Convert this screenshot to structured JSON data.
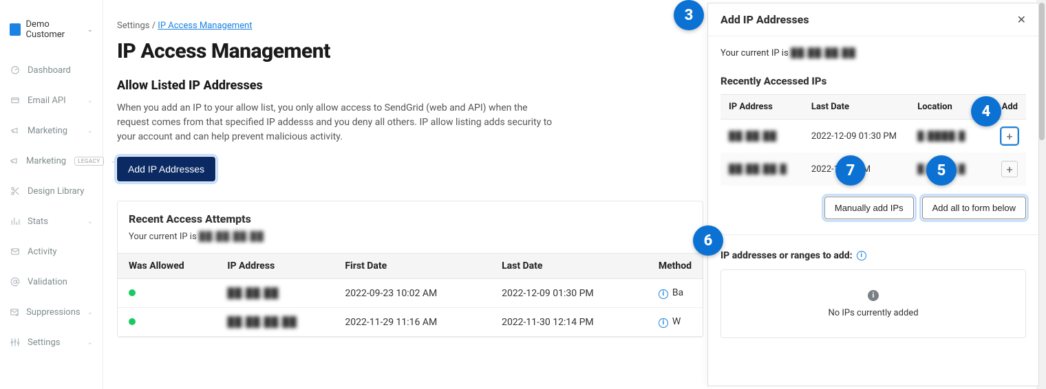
{
  "brand": {
    "name": "Demo Customer"
  },
  "sidebar": {
    "items": [
      {
        "label": "Dashboard",
        "icon": "gauge",
        "expandable": false
      },
      {
        "label": "Email API",
        "icon": "card",
        "expandable": true
      },
      {
        "label": "Marketing",
        "icon": "megaphone",
        "expandable": true
      },
      {
        "label": "Marketing",
        "icon": "megaphone",
        "expandable": true,
        "badge": "LEGACY"
      },
      {
        "label": "Design Library",
        "icon": "scissors",
        "expandable": false
      },
      {
        "label": "Stats",
        "icon": "bars",
        "expandable": true
      },
      {
        "label": "Activity",
        "icon": "mail",
        "expandable": false
      },
      {
        "label": "Validation",
        "icon": "at",
        "expandable": false
      },
      {
        "label": "Suppressions",
        "icon": "envelope-x",
        "expandable": true
      },
      {
        "label": "Settings",
        "icon": "sliders",
        "expandable": true
      }
    ]
  },
  "breadcrumb": {
    "root": "Settings",
    "sep": " / ",
    "current": "IP Access Management"
  },
  "page": {
    "title": "IP Access Management",
    "section_title": "Allow Listed IP Addresses",
    "description": "When you add an IP to your allow list, you only allow access to SendGrid (web and API) when the request comes from that specified IP addesss and you deny all others. IP allow listing adds security to your account and can help prevent malicious activity.",
    "add_button": "Add IP Addresses"
  },
  "recent": {
    "title": "Recent Access Attempts",
    "your_ip_label": "Your current IP is",
    "your_ip_value": "██.██.██.██",
    "headers": [
      "Was Allowed",
      "IP Address",
      "First Date",
      "Last Date",
      "Method"
    ],
    "rows": [
      {
        "allowed": true,
        "ip": "██.██.██",
        "first": "2022-09-23 10:02 AM",
        "last": "2022-12-09 01:30 PM",
        "method": "Ba"
      },
      {
        "allowed": true,
        "ip": "██.██.██.██",
        "first": "2022-11-29 11:16 AM",
        "last": "2022-11-30 12:14 PM",
        "method": "W"
      }
    ]
  },
  "panel": {
    "title": "Add IP Addresses",
    "your_ip_label": "Your current IP is",
    "your_ip_value": "██.██.██.██",
    "recent_title": "Recently Accessed IPs",
    "headers": {
      "ip": "IP Address",
      "last": "Last Date",
      "loc": "Location",
      "add": "Add"
    },
    "rows": [
      {
        "ip": "██.██.██",
        "last": "2022-12-09 01:30 PM",
        "loc": "█.████.█",
        "highlight": true
      },
      {
        "ip": "██.██.██.█",
        "last": "2022-1…14 PM",
        "loc": "█.████.█",
        "highlight": false
      }
    ],
    "btn_manual": "Manually add IPs",
    "btn_addall": "Add all to form below",
    "to_add_title": "IP addresses or ranges to add:",
    "empty_text": "No IPs currently added"
  },
  "callouts": {
    "c3": "3",
    "c4": "4",
    "c5": "5",
    "c6": "6",
    "c7": "7"
  }
}
